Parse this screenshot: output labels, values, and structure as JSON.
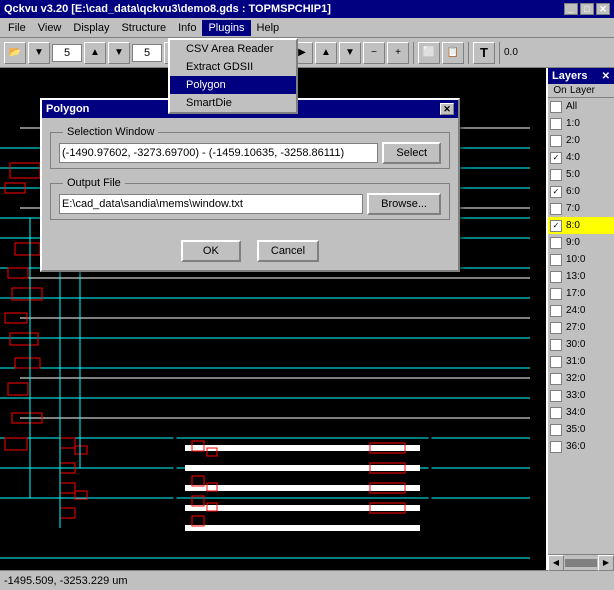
{
  "titlebar": {
    "title": "Qckvu v3.20 [E:\\cad_data\\qckvu3\\demo8.gds : TOPMSPCHIP1]",
    "minimize": "_",
    "maximize": "□",
    "close": "✕"
  },
  "menubar": {
    "items": [
      {
        "id": "file",
        "label": "File"
      },
      {
        "id": "view",
        "label": "View"
      },
      {
        "id": "display",
        "label": "Display"
      },
      {
        "id": "structure",
        "label": "Structure"
      },
      {
        "id": "info",
        "label": "Info"
      },
      {
        "id": "plugins",
        "label": "Plugins"
      },
      {
        "id": "help",
        "label": "Help"
      }
    ]
  },
  "plugins_menu": {
    "items": [
      {
        "id": "csv",
        "label": "CSV Area Reader"
      },
      {
        "id": "gdsii",
        "label": "Extract GDSII"
      },
      {
        "id": "polygon",
        "label": "Polygon",
        "selected": true
      },
      {
        "id": "smartdie",
        "label": "SmartDie"
      }
    ]
  },
  "toolbar": {
    "zoom_in": "+",
    "zoom_out": "-",
    "grid1": "5",
    "grid2": "5"
  },
  "dialog": {
    "title": "Polygon",
    "close": "✕",
    "selection_window_label": "Selection Window",
    "coordinates": "(-1490.97602, -3273.69700) - (-1459.10635, -3258.86111)",
    "select_btn": "Select",
    "output_file_label": "Output File",
    "file_path": "E:\\cad_data\\sandia\\mems\\window.txt",
    "browse_btn": "Browse...",
    "ok_btn": "OK",
    "cancel_btn": "Cancel"
  },
  "layers": {
    "title": "Layers",
    "col_on": "On",
    "col_layer": "Layer",
    "items": [
      {
        "name": "All",
        "checked": false
      },
      {
        "name": "1:0",
        "checked": false
      },
      {
        "name": "2:0",
        "checked": false
      },
      {
        "name": "4:0",
        "checked": true
      },
      {
        "name": "5:0",
        "checked": false
      },
      {
        "name": "6:0",
        "checked": true
      },
      {
        "name": "7:0",
        "checked": false
      },
      {
        "name": "8:0",
        "checked": true,
        "highlighted": true
      },
      {
        "name": "9:0",
        "checked": false
      },
      {
        "name": "10:0",
        "checked": false
      },
      {
        "name": "13:0",
        "checked": false
      },
      {
        "name": "17:0",
        "checked": false
      },
      {
        "name": "24:0",
        "checked": false
      },
      {
        "name": "27:0",
        "checked": false
      },
      {
        "name": "30:0",
        "checked": false
      },
      {
        "name": "31:0",
        "checked": false
      },
      {
        "name": "32:0",
        "checked": false
      },
      {
        "name": "33:0",
        "checked": false
      },
      {
        "name": "34:0",
        "checked": false
      },
      {
        "name": "35:0",
        "checked": false
      },
      {
        "name": "36:0",
        "checked": false
      }
    ]
  },
  "statusbar": {
    "coords": "-1495.509, -3253.229 um"
  }
}
